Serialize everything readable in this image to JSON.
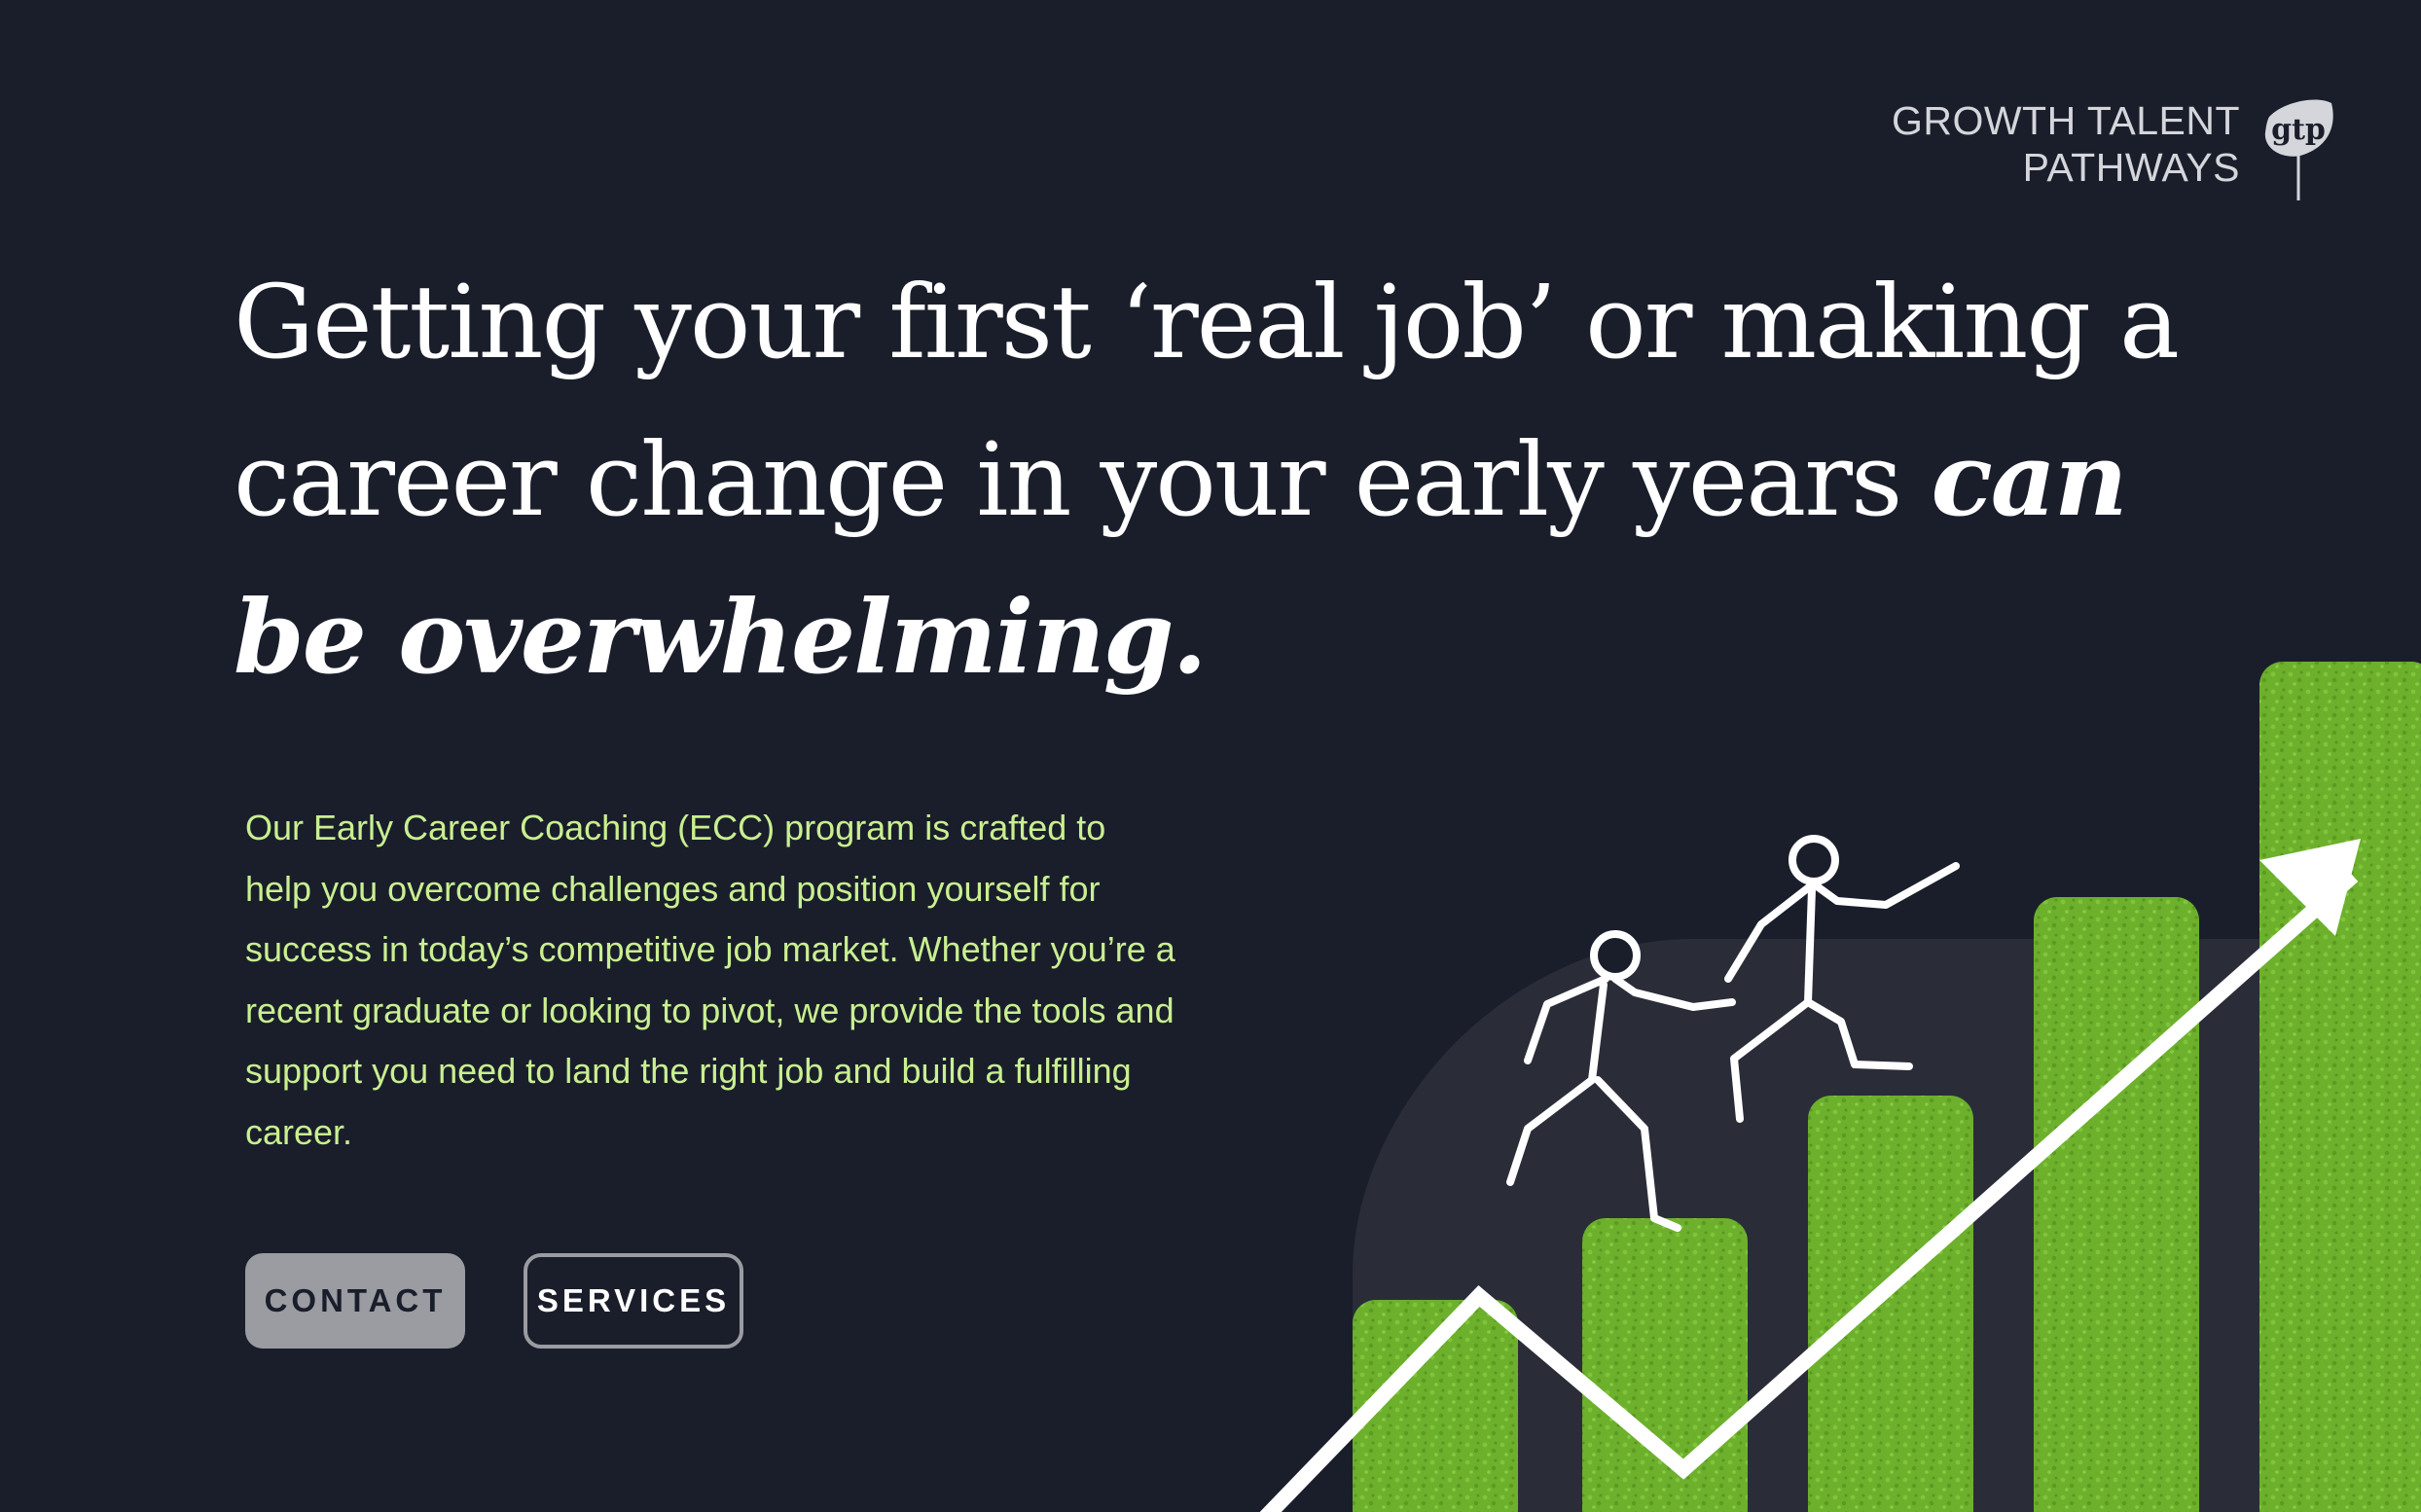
{
  "brand": {
    "line1": "GROWTH TALENT",
    "line2": "PATHWAYS",
    "mark": "gtp",
    "mark_icon": "leaf-logo-icon"
  },
  "hero": {
    "headline_plain": "Getting your first ‘real job’ or making a career change in your early years ",
    "headline_emphasis": "can be overwhelming.",
    "body": "Our Early Career Coaching (ECC) program is crafted to help you overcome challenges and position yourself for success in today’s competitive job market. Whether you’re a recent graduate or looking to pivot, we provide the tools and support you need to land the right job and build a fulfilling career."
  },
  "buttons": {
    "contact": "CONTACT",
    "services": "SERVICES"
  },
  "illustration": {
    "icon": "growth-chart-climbers-illustration",
    "bar_color": "#6fb52e",
    "arrow_color": "#ffffff",
    "backdrop_color": "#2a2d38"
  },
  "colors": {
    "background": "#1a1e2b",
    "accent_text": "#c9ef90",
    "button_grey": "#9a9ca2"
  }
}
